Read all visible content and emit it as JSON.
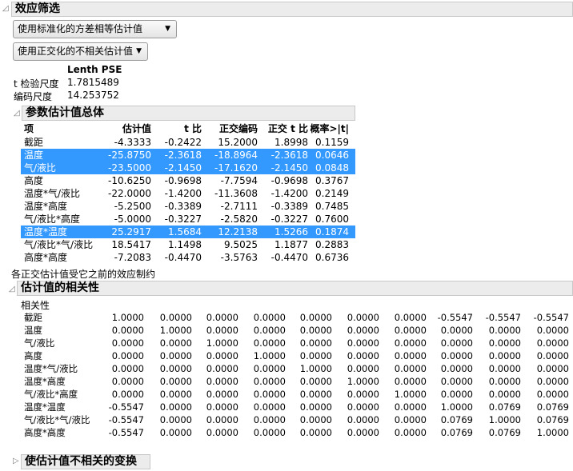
{
  "screening": {
    "title": "效应筛选",
    "dropdown1": "使用标准化的方差相等估计值",
    "dropdown2": "使用正交化的不相关估计值",
    "lenth_header": "Lenth PSE",
    "t_label": "t 检验尺度",
    "t_value": "1.7815489",
    "code_label": "编码尺度",
    "code_value": "14.253752"
  },
  "params": {
    "title": "参数估计值总体",
    "headers": [
      "项",
      "估计值",
      "t 比",
      "正交编码",
      "正交 t 比",
      "概率>|t|"
    ],
    "rows": [
      {
        "term": "截距",
        "v": [
          "-4.3333",
          "-0.2422",
          "15.2000",
          "1.8998",
          "0.1159"
        ],
        "selected": false
      },
      {
        "term": "温度",
        "v": [
          "-25.8750",
          "-2.3618",
          "-18.8964",
          "-2.3618",
          "0.0646"
        ],
        "selected": true
      },
      {
        "term": "气/液比",
        "v": [
          "-23.5000",
          "-2.1450",
          "-17.1620",
          "-2.1450",
          "0.0848"
        ],
        "selected": true
      },
      {
        "term": "高度",
        "v": [
          "-10.6250",
          "-0.9698",
          "-7.7594",
          "-0.9698",
          "0.3767"
        ],
        "selected": false
      },
      {
        "term": "温度*气/液比",
        "v": [
          "-22.0000",
          "-1.4200",
          "-11.3608",
          "-1.4200",
          "0.2149"
        ],
        "selected": false
      },
      {
        "term": "温度*高度",
        "v": [
          "-5.2500",
          "-0.3389",
          "-2.7111",
          "-0.3389",
          "0.7485"
        ],
        "selected": false
      },
      {
        "term": "气/液比*高度",
        "v": [
          "-5.0000",
          "-0.3227",
          "-2.5820",
          "-0.3227",
          "0.7600"
        ],
        "selected": false
      },
      {
        "term": "温度*温度",
        "v": [
          "25.2917",
          "1.5684",
          "12.2138",
          "1.5266",
          "0.1874"
        ],
        "selected": true
      },
      {
        "term": "气/液比*气/液比",
        "v": [
          "18.5417",
          "1.1498",
          "9.5025",
          "1.1877",
          "0.2883"
        ],
        "selected": false
      },
      {
        "term": "高度*高度",
        "v": [
          "-7.2083",
          "-0.4470",
          "-3.5763",
          "-0.4470",
          "0.6736"
        ],
        "selected": false
      }
    ],
    "note": "各正交估计值受它之前的效应制约"
  },
  "corr": {
    "title": "估计值的相关性",
    "label": "相关性",
    "rows": [
      {
        "term": "截距",
        "v": [
          "1.0000",
          "0.0000",
          "0.0000",
          "0.0000",
          "0.0000",
          "0.0000",
          "0.0000",
          "-0.5547",
          "-0.5547",
          "-0.5547"
        ]
      },
      {
        "term": "温度",
        "v": [
          "0.0000",
          "1.0000",
          "0.0000",
          "0.0000",
          "0.0000",
          "0.0000",
          "0.0000",
          "0.0000",
          "0.0000",
          "0.0000"
        ]
      },
      {
        "term": "气/液比",
        "v": [
          "0.0000",
          "0.0000",
          "1.0000",
          "0.0000",
          "0.0000",
          "0.0000",
          "0.0000",
          "0.0000",
          "0.0000",
          "0.0000"
        ]
      },
      {
        "term": "高度",
        "v": [
          "0.0000",
          "0.0000",
          "0.0000",
          "1.0000",
          "0.0000",
          "0.0000",
          "0.0000",
          "0.0000",
          "0.0000",
          "0.0000"
        ]
      },
      {
        "term": "温度*气/液比",
        "v": [
          "0.0000",
          "0.0000",
          "0.0000",
          "0.0000",
          "1.0000",
          "0.0000",
          "0.0000",
          "0.0000",
          "0.0000",
          "0.0000"
        ]
      },
      {
        "term": "温度*高度",
        "v": [
          "0.0000",
          "0.0000",
          "0.0000",
          "0.0000",
          "0.0000",
          "1.0000",
          "0.0000",
          "0.0000",
          "0.0000",
          "0.0000"
        ]
      },
      {
        "term": "气/液比*高度",
        "v": [
          "0.0000",
          "0.0000",
          "0.0000",
          "0.0000",
          "0.0000",
          "0.0000",
          "1.0000",
          "0.0000",
          "0.0000",
          "0.0000"
        ]
      },
      {
        "term": "温度*温度",
        "v": [
          "-0.5547",
          "0.0000",
          "0.0000",
          "0.0000",
          "0.0000",
          "0.0000",
          "0.0000",
          "1.0000",
          "0.0769",
          "0.0769"
        ]
      },
      {
        "term": "气/液比*气/液比",
        "v": [
          "-0.5547",
          "0.0000",
          "0.0000",
          "0.0000",
          "0.0000",
          "0.0000",
          "0.0000",
          "0.0769",
          "1.0000",
          "0.0769"
        ]
      },
      {
        "term": "高度*高度",
        "v": [
          "-0.5547",
          "0.0000",
          "0.0000",
          "0.0000",
          "0.0000",
          "0.0000",
          "0.0000",
          "0.0769",
          "0.0769",
          "1.0000"
        ]
      }
    ]
  },
  "transform": {
    "title": "使估计值不相关的变换"
  }
}
